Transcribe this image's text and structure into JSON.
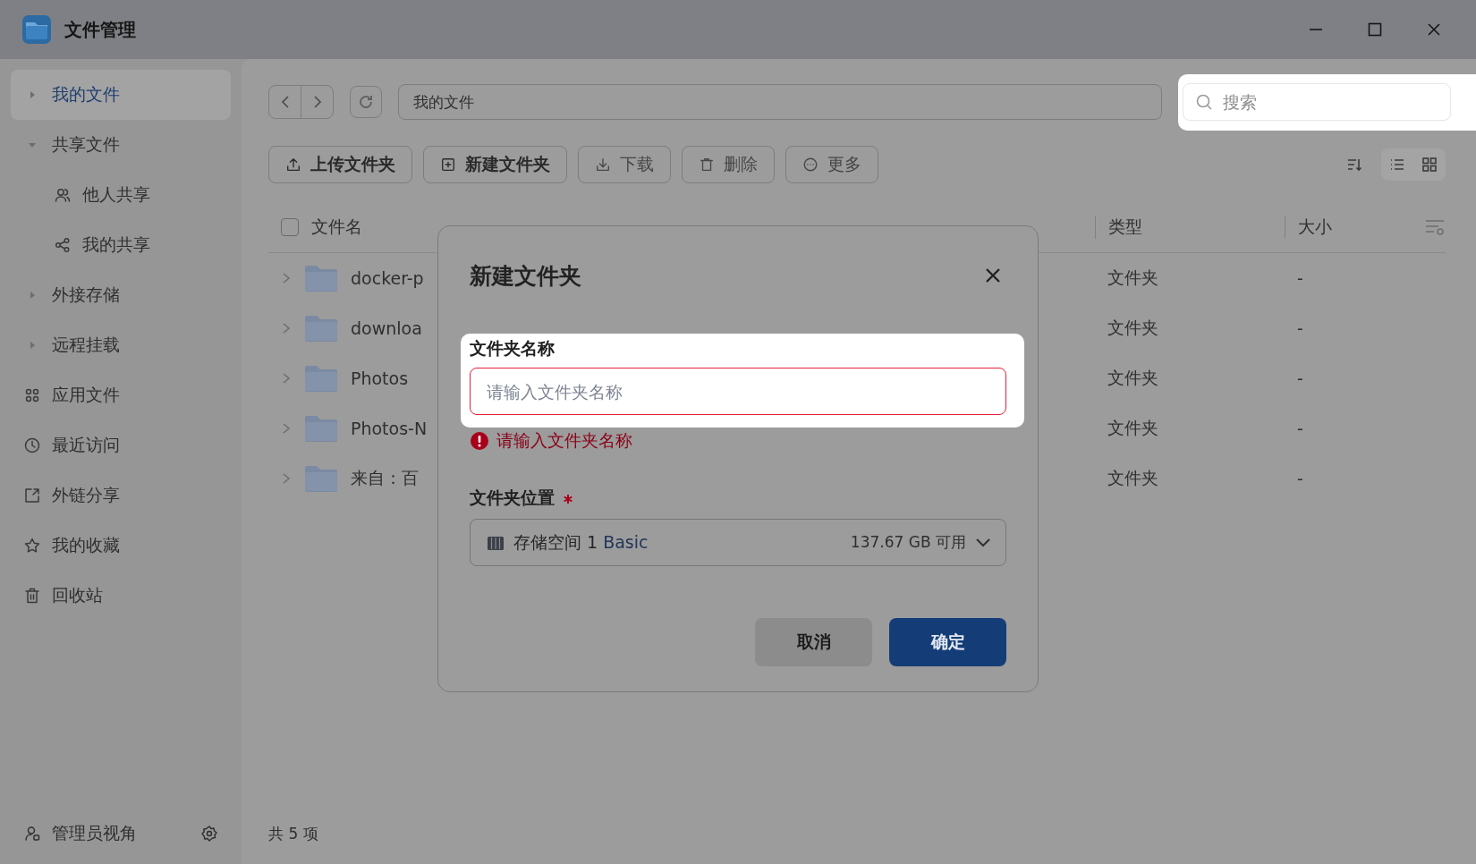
{
  "window": {
    "title": "文件管理"
  },
  "sidebar": {
    "items": [
      {
        "label": "我的文件",
        "kind": "tree",
        "expanded": false,
        "selected": true
      },
      {
        "label": "共享文件",
        "kind": "tree",
        "expanded": true,
        "selected": false,
        "children": [
          {
            "label": "他人共享",
            "kind": "people",
            "selected": false
          },
          {
            "label": "我的共享",
            "kind": "share",
            "selected": false
          }
        ]
      },
      {
        "label": "外接存储",
        "kind": "tree",
        "expanded": false,
        "selected": false
      },
      {
        "label": "远程挂载",
        "kind": "tree",
        "expanded": false,
        "selected": false
      },
      {
        "label": "应用文件",
        "kind": "apps",
        "selected": false
      },
      {
        "label": "最近访问",
        "kind": "recent",
        "selected": false
      },
      {
        "label": "外链分享",
        "kind": "outlink",
        "selected": false
      },
      {
        "label": "我的收藏",
        "kind": "star",
        "selected": false
      },
      {
        "label": "回收站",
        "kind": "trash",
        "selected": false
      }
    ],
    "footer": {
      "label": "管理员视角"
    }
  },
  "toolbar": {
    "path": "我的文件",
    "search": {
      "placeholder": "搜索"
    },
    "buttons": [
      {
        "label": "上传文件夹",
        "kind": "upload",
        "disabled": false
      },
      {
        "label": "新建文件夹",
        "kind": "newfolder",
        "disabled": false
      },
      {
        "label": "下载",
        "kind": "download",
        "disabled": true
      },
      {
        "label": "删除",
        "kind": "delete",
        "disabled": true
      },
      {
        "label": "更多",
        "kind": "more",
        "disabled": true
      }
    ]
  },
  "table": {
    "select_all": {
      "checked": false
    },
    "columns": [
      "文件名",
      "类型",
      "大小"
    ],
    "rows": [
      {
        "name": "docker-p",
        "type": "文件夹",
        "size": "-"
      },
      {
        "name": "downloa",
        "type": "文件夹",
        "size": "-"
      },
      {
        "name": "Photos",
        "type": "文件夹",
        "size": "-"
      },
      {
        "name": "Photos-N",
        "type": "文件夹",
        "size": "-"
      },
      {
        "name": "来自：百",
        "type": "文件夹",
        "size": "-"
      }
    ]
  },
  "status_bar": "共 5 项",
  "dialog": {
    "title": "新建文件夹",
    "name_field": {
      "label": "文件夹名称",
      "placeholder": "请输入文件夹名称",
      "error": "请输入文件夹名称"
    },
    "location_field": {
      "label": "文件夹位置",
      "required": true,
      "value": "存储空间 1",
      "tier": "Basic",
      "free": "137.67 GB 可用"
    },
    "buttons": [
      {
        "label": "取消",
        "kind": "secondary"
      },
      {
        "label": "确定",
        "kind": "primary"
      }
    ]
  }
}
